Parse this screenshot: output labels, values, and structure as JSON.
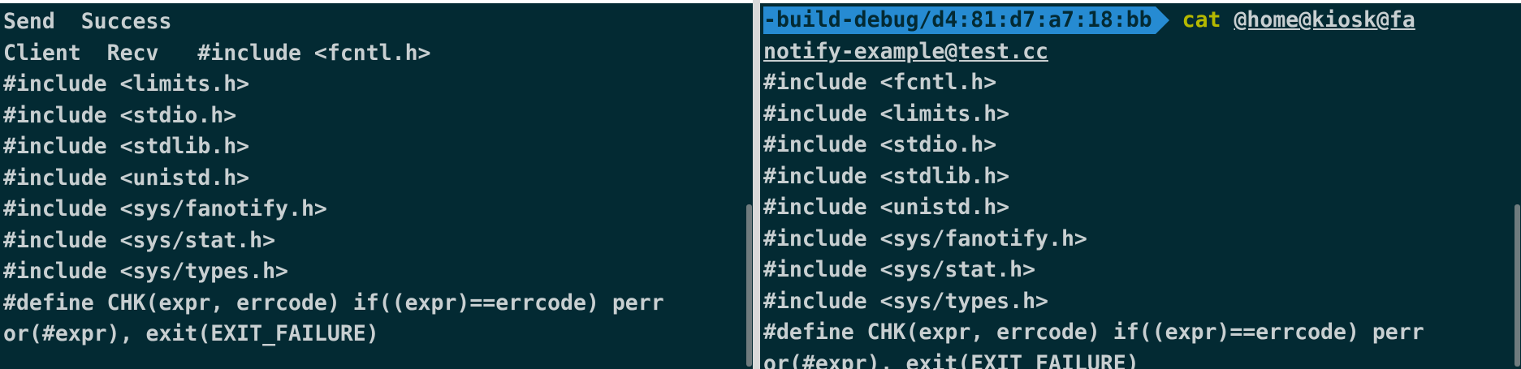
{
  "left_terminal": {
    "lines": [
      "Send  Success",
      "Client  Recv   #include <fcntl.h>",
      "#include <limits.h>",
      "#include <stdio.h>",
      "#include <stdlib.h>",
      "#include <unistd.h>",
      "#include <sys/fanotify.h>",
      "#include <sys/stat.h>",
      "#include <sys/types.h>",
      "#define CHK(expr, errcode) if((expr)==errcode) perr",
      "or(#expr), exit(EXIT_FAILURE)"
    ]
  },
  "right_terminal": {
    "prompt_path": "-build-debug/d4:81:d7:a7:18:bb",
    "command": "cat",
    "argument_line1": "@home@kiosk@fa",
    "argument_line2": "notify-example@test.cc",
    "lines": [
      "#include <fcntl.h>",
      "#include <limits.h>",
      "#include <stdio.h>",
      "#include <stdlib.h>",
      "#include <unistd.h>",
      "#include <sys/fanotify.h>",
      "#include <sys/stat.h>",
      "#include <sys/types.h>",
      "#define CHK(expr, errcode) if((expr)==errcode) perr",
      "or(#expr), exit(EXIT_FAILURE)"
    ]
  },
  "colors": {
    "background": "#032a33",
    "text": "#c8cfd1",
    "prompt_segment": "#268bd2",
    "command": "#b5b800"
  }
}
